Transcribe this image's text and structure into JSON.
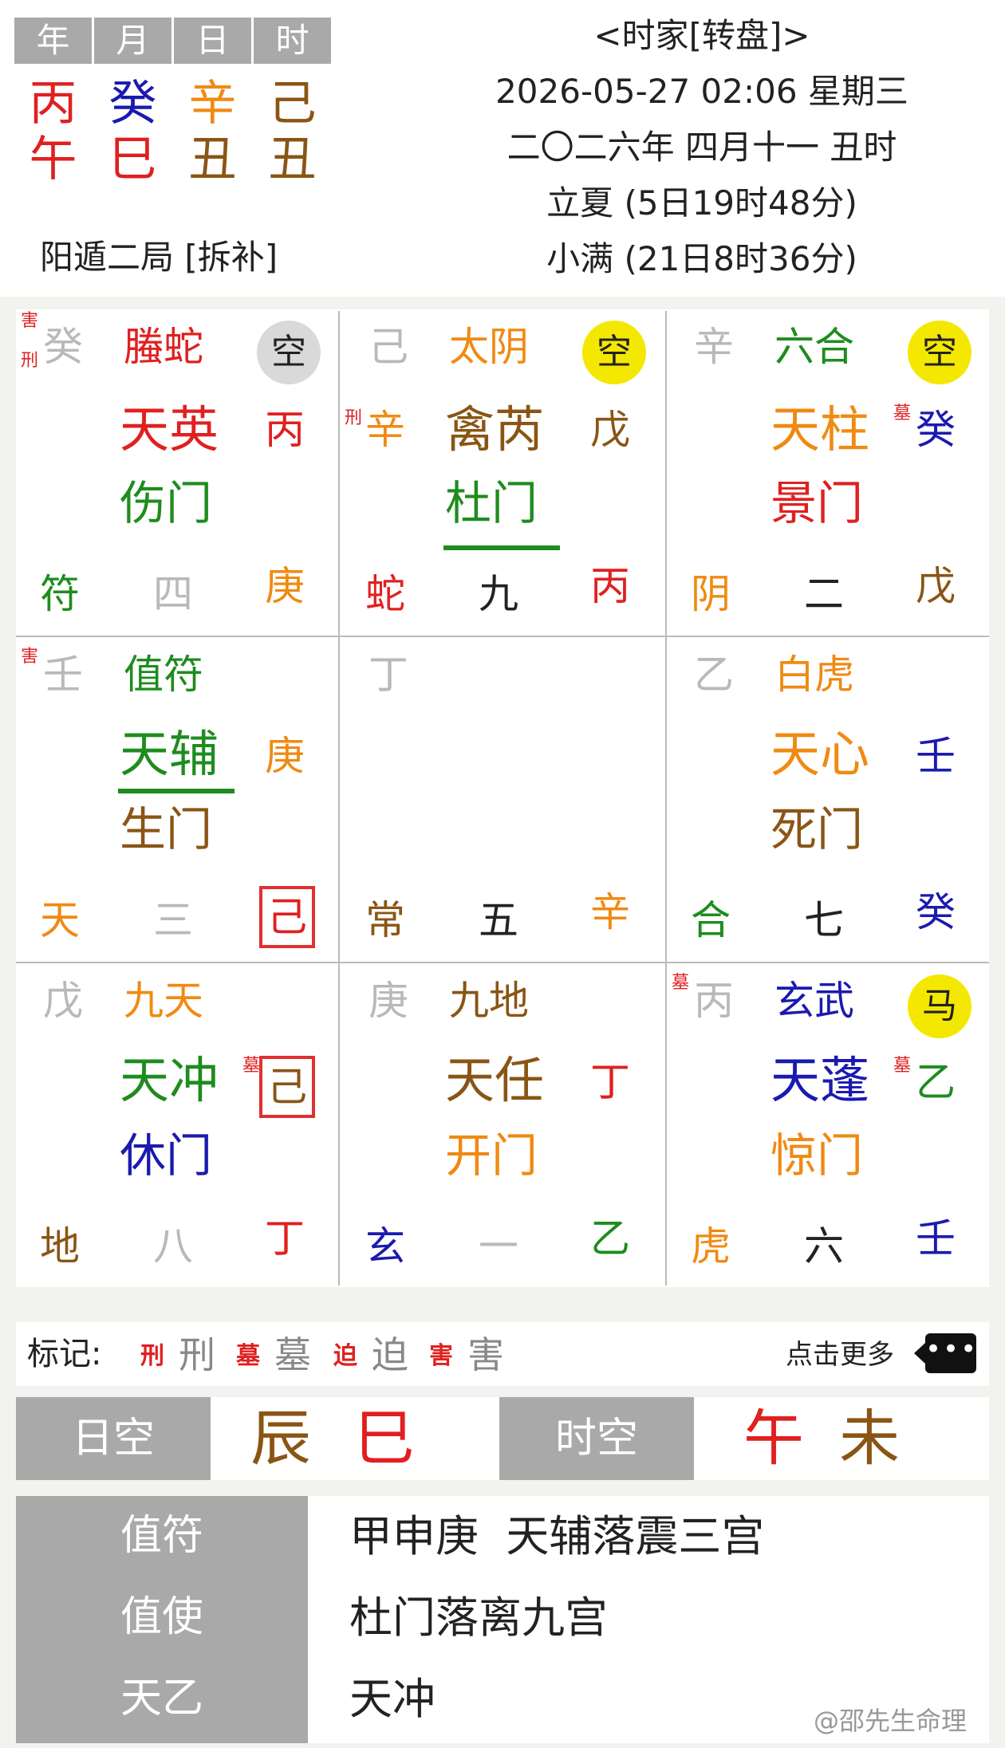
{
  "header": {
    "pillar_labels": [
      "年",
      "月",
      "日",
      "时"
    ],
    "stems": [
      "丙",
      "癸",
      "辛",
      "己"
    ],
    "branches": [
      "午",
      "巳",
      "丑",
      "丑"
    ],
    "ju": "阳遁二局 [拆补]",
    "title": "<时家[转盘]>",
    "datetime": "2026-05-27 02:06 星期三",
    "lunar": "二〇二六年 四月十一 丑时",
    "solar_term_1": "立夏 (5日19时48分)",
    "solar_term_2": "小满 (21日8时36分)"
  },
  "palaces": [
    {
      "marks": [
        "害",
        "刑"
      ],
      "heaven_stem": "癸",
      "god": "螣蛇",
      "badge": "空",
      "star": "天英",
      "star_stem": "丙",
      "door": "伤门",
      "god_short": "符",
      "number": "四",
      "earth_stem": "庚"
    },
    {
      "marks": [],
      "heaven_stem": "己",
      "god": "太阴",
      "badge": "空",
      "star_mark": "刑",
      "star_pre": "辛",
      "star": "禽芮",
      "star_stem": "戊",
      "door": "杜门",
      "god_short": "蛇",
      "number": "九",
      "earth_stem": "丙"
    },
    {
      "marks": [],
      "heaven_stem": "辛",
      "god": "六合",
      "badge": "空",
      "star": "天柱",
      "star_mark": "墓",
      "star_stem": "癸",
      "door": "景门",
      "god_short": "阴",
      "number": "二",
      "earth_stem": "戊"
    },
    {
      "marks": [
        "害"
      ],
      "heaven_stem": "壬",
      "god": "值符",
      "star": "天辅",
      "star_stem": "庚",
      "door": "生门",
      "god_short": "天",
      "number": "三",
      "earth_stem": "己"
    },
    {
      "marks": [],
      "heaven_stem": "丁",
      "god_short": "常",
      "number": "五",
      "earth_stem": "辛"
    },
    {
      "marks": [],
      "heaven_stem": "乙",
      "god": "白虎",
      "star": "天心",
      "star_stem": "壬",
      "door": "死门",
      "god_short": "合",
      "number": "七",
      "earth_stem": "癸"
    },
    {
      "marks": [],
      "heaven_stem": "戊",
      "god": "九天",
      "star": "天冲",
      "star_mark": "墓",
      "star_stem": "己",
      "door": "休门",
      "god_short": "地",
      "number": "八",
      "earth_stem": "丁"
    },
    {
      "marks": [],
      "heaven_stem": "庚",
      "god": "九地",
      "star": "天任",
      "star_stem": "丁",
      "door": "开门",
      "god_short": "玄",
      "number": "一",
      "earth_stem": "乙"
    },
    {
      "marks": [
        "墓"
      ],
      "heaven_stem": "丙",
      "god": "玄武",
      "badge": "马",
      "star": "天蓬",
      "star_mark": "墓",
      "star_stem": "乙",
      "door": "惊门",
      "god_short": "虎",
      "number": "六",
      "earth_stem": "壬"
    }
  ],
  "legend": {
    "label": "标记:",
    "items": [
      {
        "small": "刑",
        "big": "刑"
      },
      {
        "small": "墓",
        "big": "墓"
      },
      {
        "small": "迫",
        "big": "迫"
      },
      {
        "small": "害",
        "big": "害"
      }
    ],
    "more": "点击更多",
    "more_icon": "ellipsis-icon"
  },
  "kong": {
    "day_label": "日空",
    "day_values": [
      "辰",
      "巳"
    ],
    "hour_label": "时空",
    "hour_values": [
      "午",
      "未"
    ]
  },
  "details": [
    {
      "label": "值符",
      "value": "甲申庚  天辅落震三宫"
    },
    {
      "label": "值使",
      "value": "杜门落离九宫"
    },
    {
      "label": "天乙",
      "value": "天冲"
    }
  ],
  "watermark": "@邵先生命理",
  "colors": {
    "red": "#e02020",
    "blue": "#1a1ab0",
    "orange": "#f08a12",
    "brown": "#8a5514",
    "green": "#1e8c1e",
    "gray": "#b9b9b9",
    "badge_yellow": "#f5e800",
    "badge_gray": "#d9d9d9"
  }
}
